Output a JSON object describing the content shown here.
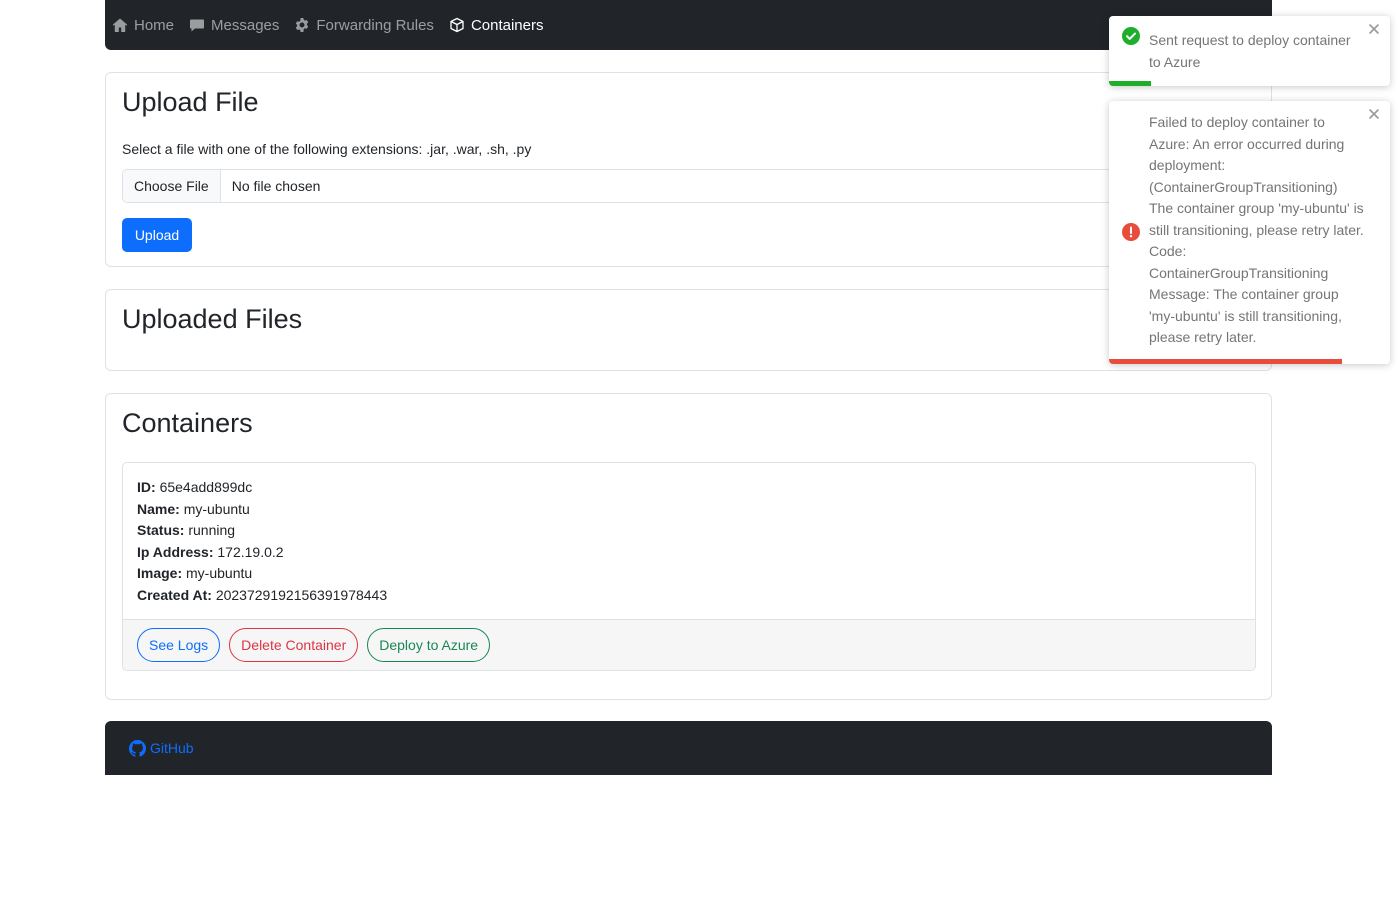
{
  "nav": {
    "items": [
      {
        "label": "Home",
        "active": false
      },
      {
        "label": "Messages",
        "active": false
      },
      {
        "label": "Forwarding Rules",
        "active": false
      },
      {
        "label": "Containers",
        "active": true
      }
    ]
  },
  "upload": {
    "title": "Upload File",
    "hint": "Select a file with one of the following extensions: .jar, .war, .sh, .py",
    "choose_label": "Choose File",
    "file_status": "No file chosen",
    "button_label": "Upload"
  },
  "uploaded": {
    "title": "Uploaded Files"
  },
  "containers": {
    "title": "Containers",
    "items": [
      {
        "id_label": "ID:",
        "id": "65e4add899dc",
        "name_label": "Name:",
        "name": "my-ubuntu",
        "status_label": "Status:",
        "status": "running",
        "ip_label": "Ip Address:",
        "ip": "172.19.0.2",
        "image_label": "Image:",
        "image": "my-ubuntu",
        "created_label": "Created At:",
        "created": "2023729192156391978443",
        "actions": {
          "logs": "See Logs",
          "delete": "Delete Container",
          "deploy": "Deploy to Azure"
        }
      }
    ]
  },
  "footer": {
    "github_label": "GitHub"
  },
  "toasts": [
    {
      "type": "success",
      "message": "Sent request to deploy container to Azure",
      "progress": 0.15,
      "color": "#1fad2c"
    },
    {
      "type": "error",
      "message": "Failed to deploy container to Azure: An error occurred during deployment: (ContainerGroupTransitioning) The container group 'my-ubuntu' is still transitioning, please retry later. Code: ContainerGroupTransitioning Message: The container group 'my-ubuntu' is still transitioning, please retry later.",
      "progress": 0.83,
      "color": "#e74c3c"
    }
  ],
  "colors": {
    "navbar_bg": "#212529",
    "primary": "#0d6efd",
    "danger": "#dc3545",
    "success": "#198754"
  },
  "icons": {
    "home": "house-icon",
    "messages": "chat-bubble-icon",
    "rules": "gear-icon",
    "containers": "box-icon",
    "github": "github-icon",
    "success": "check-circle-icon",
    "error": "exclamation-circle-icon",
    "close": "close-icon"
  }
}
